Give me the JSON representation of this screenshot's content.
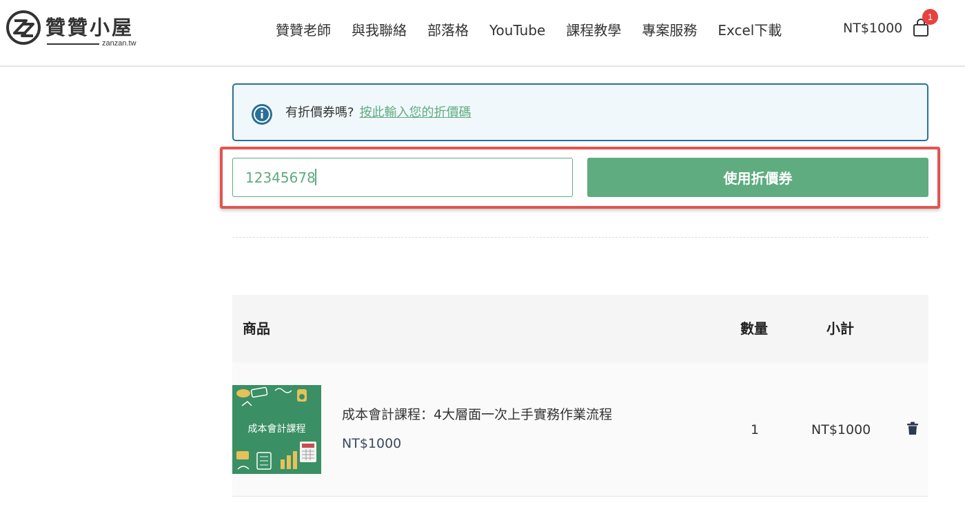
{
  "site": {
    "logo_title": "贊贊小屋",
    "logo_sub": "zanzan.tw"
  },
  "nav": {
    "items": [
      {
        "label": "贊贊老師"
      },
      {
        "label": "與我聯絡"
      },
      {
        "label": "部落格"
      },
      {
        "label": "YouTube"
      },
      {
        "label": "課程教學"
      },
      {
        "label": "專案服務"
      },
      {
        "label": "Excel下載"
      }
    ],
    "cart_total": "NT$1000",
    "cart_count": "1"
  },
  "coupon": {
    "notice_text": "有折價券嗎?",
    "notice_link": "按此輸入您的折價碼",
    "input_value": "12345678",
    "apply_label": "使用折價券"
  },
  "cart": {
    "headers": {
      "product": "商品",
      "quantity": "數量",
      "subtotal": "小計"
    },
    "items": [
      {
        "thumbnail_text": "成本會計課程",
        "name": "成本會計課程：4大層面一次上手實務作業流程",
        "price": "NT$1000",
        "quantity": "1",
        "subtotal": "NT$1000"
      }
    ]
  },
  "colors": {
    "accent": "#5eac7f",
    "notice_border": "#2a6f97",
    "highlight": "#e1544f",
    "badge": "#e9413d"
  },
  "icons": {
    "logo": "zz-logo-icon",
    "cart": "shopping-bag-icon",
    "info": "info-icon",
    "delete": "trash-icon"
  }
}
